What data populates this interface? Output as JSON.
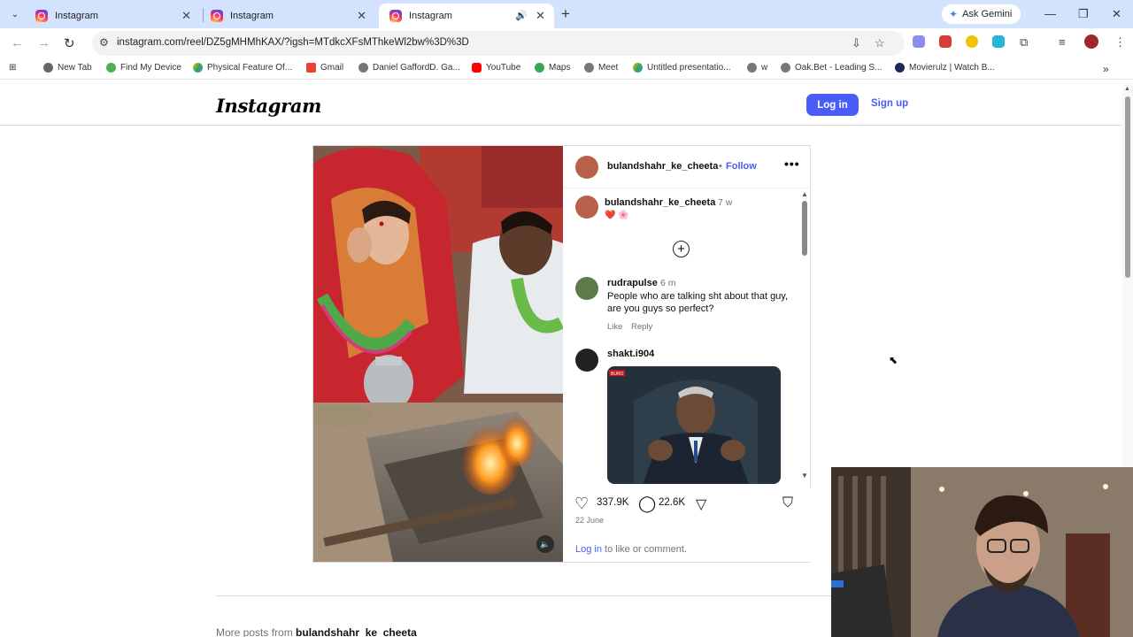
{
  "browser": {
    "tabs": [
      {
        "title": "Instagram",
        "active": false
      },
      {
        "title": "Instagram",
        "active": false
      },
      {
        "title": "Instagram",
        "active": true
      }
    ],
    "gemini_label": "Ask Gemini",
    "url": "instagram.com/reel/DZ5gMHMhKAX/?igsh=MTdkcXFsMThkeWl2bw%3D%3D",
    "bookmarks": [
      "New Tab",
      "Find My Device",
      "Physical Feature Of...",
      "Gmail",
      "Daniel GaffordD. Ga...",
      "YouTube",
      "Maps",
      "Meet",
      "Untitled presentatio...",
      "w",
      "Oak.Bet - Leading S...",
      "Movierulz | Watch B..."
    ]
  },
  "instagram": {
    "logo": "Instagram",
    "login_label": "Log in",
    "signup_label": "Sign up",
    "post": {
      "author": "bulandshahr_ke_cheeta",
      "separator": "•",
      "follow_label": "Follow",
      "caption_author": "bulandshahr_ke_cheeta",
      "caption_time": "7 w",
      "caption_emoji": "❤️ 🌸",
      "comments": [
        {
          "user": "rudrapulse",
          "time": "6 m",
          "text": "People who are talking sht about that guy, are you guys so perfect?",
          "like_label": "Like",
          "reply_label": "Reply"
        },
        {
          "user": "shakt.i904",
          "gif_label": "BURO"
        }
      ],
      "likes": "337.9K",
      "comment_count": "22.6K",
      "date": "22 June",
      "login_prompt_link": "Log in",
      "login_prompt_rest": " to like or comment."
    },
    "more_posts_prefix": "More posts from ",
    "more_posts_user": "bulandshahr_ke_cheeta"
  }
}
